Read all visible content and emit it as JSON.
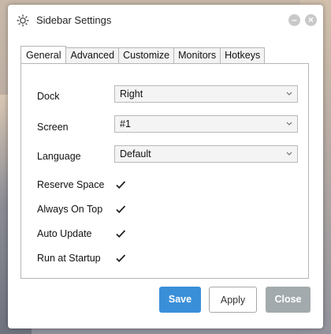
{
  "window": {
    "title": "Sidebar Settings",
    "icon": "gear-icon",
    "minimize_label": "–",
    "close_label": "×"
  },
  "tabs": [
    {
      "label": "General",
      "active": true
    },
    {
      "label": "Advanced",
      "active": false
    },
    {
      "label": "Customize",
      "active": false
    },
    {
      "label": "Monitors",
      "active": false
    },
    {
      "label": "Hotkeys",
      "active": false
    }
  ],
  "general": {
    "dock": {
      "label": "Dock",
      "value": "Right"
    },
    "screen": {
      "label": "Screen",
      "value": "#1"
    },
    "language": {
      "label": "Language",
      "value": "Default"
    },
    "reserve_space": {
      "label": "Reserve Space",
      "checked": true
    },
    "always_on_top": {
      "label": "Always On Top",
      "checked": true
    },
    "auto_update": {
      "label": "Auto Update",
      "checked": true
    },
    "run_at_startup": {
      "label": "Run at Startup",
      "checked": true
    }
  },
  "buttons": {
    "save": "Save",
    "apply": "Apply",
    "close": "Close"
  },
  "colors": {
    "primary": "#3a8fd9",
    "disabled": "#a3aaae"
  }
}
